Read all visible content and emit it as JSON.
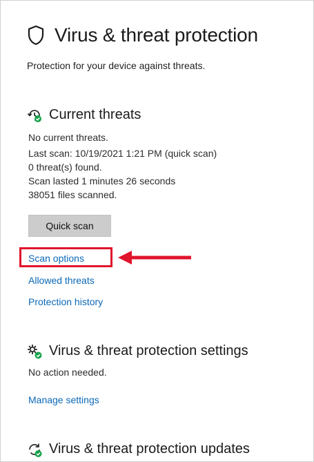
{
  "header": {
    "title": "Virus & threat protection",
    "subtitle": "Protection for your device against threats.",
    "icon": "shield-icon"
  },
  "current_threats": {
    "title": "Current threats",
    "icon": "threat-history-icon",
    "status": "No current threats.",
    "last_scan": "Last scan: 10/19/2021 1:21 PM (quick scan)",
    "threats_found": "0 threat(s) found.",
    "scan_duration": "Scan lasted 1 minutes 26 seconds",
    "files_scanned": "38051 files scanned.",
    "quick_scan_label": "Quick scan",
    "links": {
      "scan_options": "Scan options",
      "allowed_threats": "Allowed threats",
      "protection_history": "Protection history"
    }
  },
  "settings": {
    "title": "Virus & threat protection settings",
    "icon": "settings-gears-icon",
    "status": "No action needed.",
    "manage_link": "Manage settings"
  },
  "updates": {
    "title": "Virus & threat protection updates",
    "icon": "update-refresh-icon"
  },
  "colors": {
    "link": "#0a68b8",
    "highlight": "#e0142c",
    "button_bg": "#cccccc",
    "check_green": "#16a34a"
  }
}
